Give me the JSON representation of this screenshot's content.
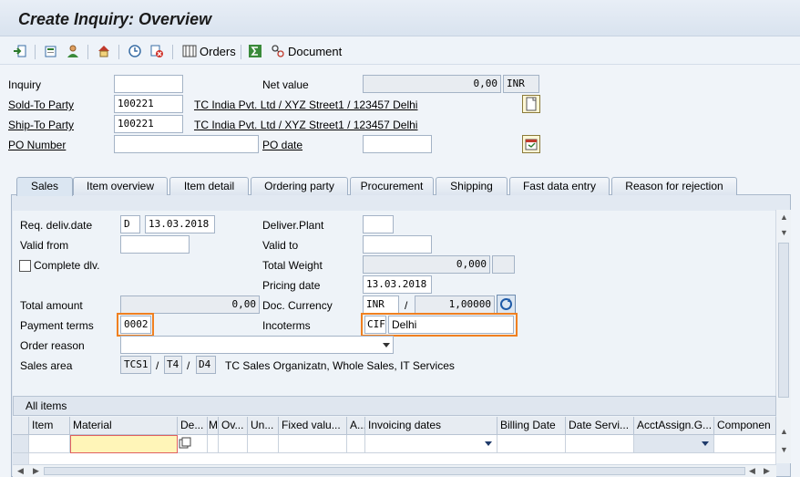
{
  "title": "Create Inquiry: Overview",
  "toolbar": {
    "orders_label": "Orders",
    "document_label": "Document"
  },
  "header": {
    "inquiry_label": "Inquiry",
    "inquiry_value": "",
    "net_value_label": "Net value",
    "net_value": "0,00",
    "net_value_currency": "INR",
    "sold_to_label": "Sold-To Party",
    "sold_to_value": "100221",
    "sold_to_desc": "TC India Pvt. Ltd / XYZ Street1 / 123457 Delhi",
    "ship_to_label": "Ship-To Party",
    "ship_to_value": "100221",
    "ship_to_desc": "TC India Pvt. Ltd / XYZ Street1 / 123457 Delhi",
    "po_number_label": "PO Number",
    "po_number_value": "",
    "po_date_label": "PO date",
    "po_date_value": ""
  },
  "tabs": [
    "Sales",
    "Item overview",
    "Item detail",
    "Ordering party",
    "Procurement",
    "Shipping",
    "Fast data entry",
    "Reason for rejection"
  ],
  "sales": {
    "req_deliv_date_label": "Req. deliv.date",
    "req_deliv_date_type": "D",
    "req_deliv_date_value": "13.03.2018",
    "deliver_plant_label": "Deliver.Plant",
    "deliver_plant_value": "",
    "valid_from_label": "Valid from",
    "valid_from_value": "",
    "valid_to_label": "Valid to",
    "valid_to_value": "",
    "complete_dlv_label": "Complete dlv.",
    "total_weight_label": "Total Weight",
    "total_weight_value": "0,000",
    "total_weight_unit": "",
    "pricing_date_label": "Pricing date",
    "pricing_date_value": "13.03.2018",
    "total_amount_label": "Total amount",
    "total_amount_value": "0,00",
    "doc_currency_label": "Doc. Currency",
    "doc_currency_value": "INR",
    "doc_currency_sep": "/",
    "doc_currency_rate": "1,00000",
    "payment_terms_label": "Payment terms",
    "payment_terms_value": "0002",
    "incoterms_label": "Incoterms",
    "incoterms_code": "CIF",
    "incoterms_place": "Delhi",
    "order_reason_label": "Order reason",
    "order_reason_value": "",
    "sales_area_label": "Sales area",
    "sales_org": "TCS1",
    "dist_channel": "T4",
    "division": "D4",
    "slash": "/",
    "sales_area_desc": "TC Sales Organizatn, Whole Sales, IT Services"
  },
  "items": {
    "title": "All items",
    "columns": [
      "Item",
      "Material",
      "De...",
      "M",
      "Ov...",
      "Un...",
      "Fixed valu...",
      "A...",
      "Invoicing dates",
      "Billing Date",
      "Date Servi...",
      "AcctAssign.G...",
      "Componen"
    ]
  },
  "colors": {
    "highlight": "#f08020",
    "title_bg": "#dde6f1"
  }
}
